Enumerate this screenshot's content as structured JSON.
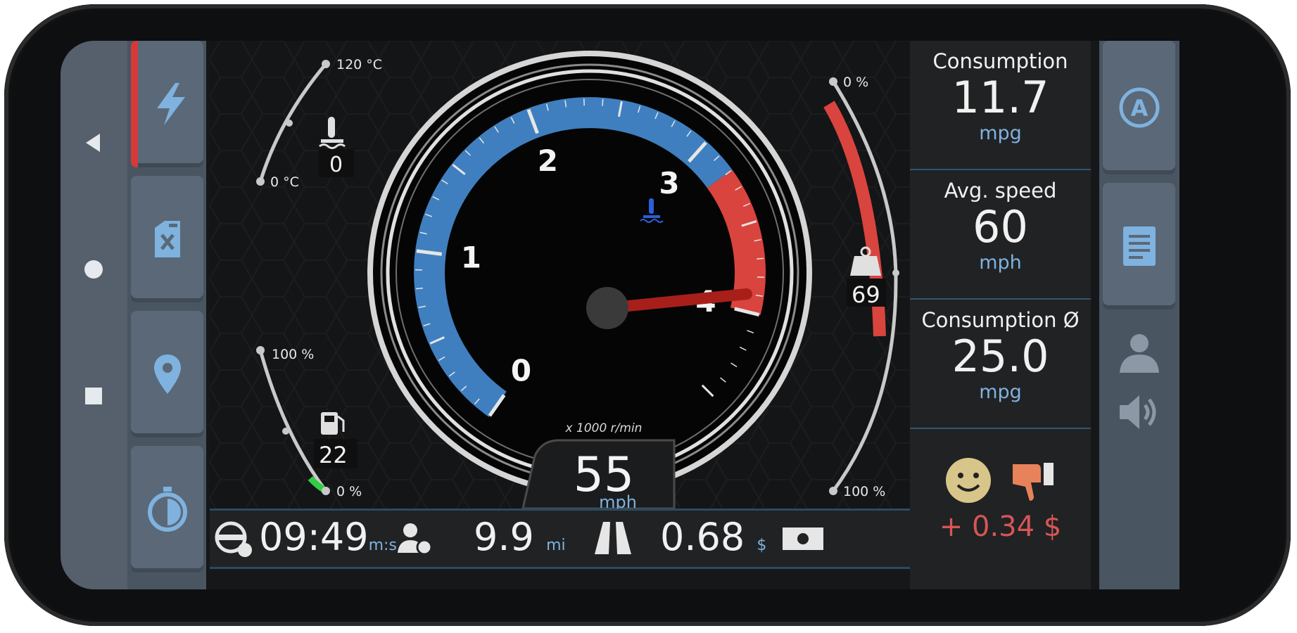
{
  "gauges": {
    "rpm_ticks": [
      "0",
      "1",
      "2",
      "3",
      "4"
    ],
    "rpm_unit": "x 1000 r/min",
    "rpm_value": 3.9,
    "speed_value": "55",
    "speed_unit": "mph",
    "temp_top": "120 °C",
    "temp_bottom": "0 °C",
    "temp_value": "0",
    "fuel_top": "100 %",
    "fuel_bottom": "0 %",
    "fuel_value": "22",
    "fuel_level": 0.22,
    "load_top": "0 %",
    "load_bottom": "100 %",
    "load_value": "69"
  },
  "metrics": [
    {
      "label": "Consumption",
      "value": "11.7",
      "unit": "mpg"
    },
    {
      "label": "Avg. speed",
      "value": "60",
      "unit": "mph"
    },
    {
      "label": "Consumption Ø",
      "value": "25.0",
      "unit": "mpg"
    }
  ],
  "savings": "+ 0.34 $",
  "bottom_bar": {
    "time": "09:49",
    "time_unit": "m:s",
    "distance": "9.9",
    "distance_unit": "mi",
    "cost": "0.68",
    "cost_unit": "$"
  },
  "colors": {
    "accent_blue": "#3f7fbf",
    "accent_red": "#d9443e",
    "active_tab": "#d43a3a",
    "savings": "#d85555",
    "smile": "#d8c58a",
    "thumb": "#e8825a"
  },
  "icons": {
    "left_sidebar": [
      "lightning-icon",
      "fuel-can-icon",
      "location-pin-icon",
      "stopwatch-icon"
    ],
    "right_sidebar": [
      "auto-mode-icon",
      "document-icon",
      "driver-icon",
      "speaker-icon"
    ]
  }
}
